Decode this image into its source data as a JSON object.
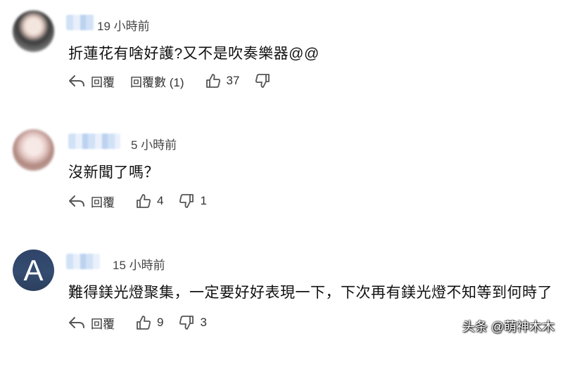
{
  "comments": [
    {
      "timestamp": "19 小時前",
      "text": "折蓮花有啥好護?又不是吹奏樂器@@",
      "reply_label": "回覆",
      "replies_label": "回覆數 (1)",
      "likes": "37",
      "dislikes": ""
    },
    {
      "timestamp": "5 小時前",
      "text": "沒新聞了嗎？",
      "reply_label": "回覆",
      "likes": "4",
      "dislikes": "1"
    },
    {
      "timestamp": "15 小時前",
      "avatar_letter": "A",
      "text": "難得鎂光燈聚集，一定要好好表現一下，下次再有鎂光燈不知等到何時了",
      "reply_label": "回覆",
      "likes": "9",
      "dislikes": "3"
    }
  ],
  "watermark": "头条 @萌神木木",
  "icons": {
    "reply": "reply-arrow-icon",
    "like": "thumbs-up-icon",
    "dislike": "thumbs-down-icon"
  }
}
